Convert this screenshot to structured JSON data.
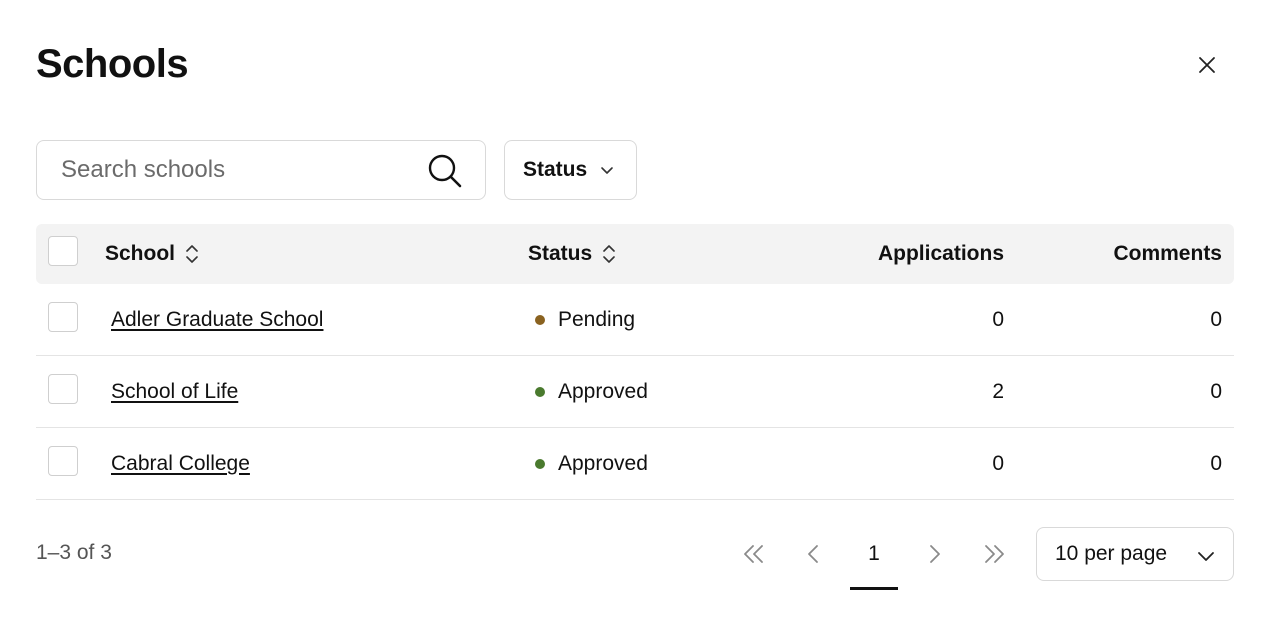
{
  "header": {
    "title": "Schools"
  },
  "toolbar": {
    "search_placeholder": "Search schools",
    "search_value": "",
    "status_filter_label": "Status"
  },
  "table": {
    "columns": {
      "school": "School",
      "status": "Status",
      "applications": "Applications",
      "comments": "Comments"
    },
    "rows": [
      {
        "school": "Adler Graduate School",
        "status": "Pending",
        "status_color": "#8a6220",
        "applications": "0",
        "comments": "0"
      },
      {
        "school": "School of Life",
        "status": "Approved",
        "status_color": "#4a7a2e",
        "applications": "2",
        "comments": "0"
      },
      {
        "school": "Cabral College",
        "status": "Approved",
        "status_color": "#4a7a2e",
        "applications": "0",
        "comments": "0"
      }
    ]
  },
  "pagination": {
    "range_text": "1–3 of 3",
    "current_page": "1",
    "per_page_label": "10 per page"
  },
  "icons": {
    "close": "close-icon",
    "search": "search-icon",
    "status_dropdown": "chevron-down-icon",
    "sort": "sort-icon",
    "first": "chevrons-left-icon",
    "prev": "chevron-left-icon",
    "next": "chevron-right-icon",
    "last": "chevrons-right-icon",
    "per_page_dropdown": "chevron-down-icon"
  }
}
